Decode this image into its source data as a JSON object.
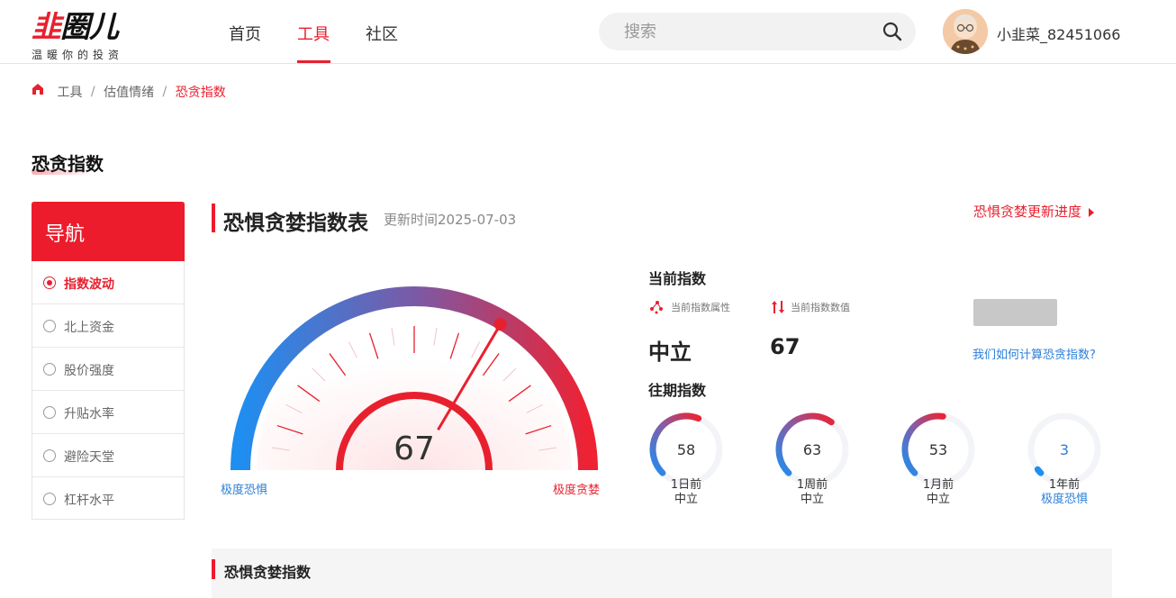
{
  "brand": {
    "logo": "韭圈儿",
    "slogan": "温暖你的投资",
    "accent": "#e8202e",
    "blue": "#2b7fd9"
  },
  "nav": {
    "items": [
      "首页",
      "工具",
      "社区"
    ],
    "active": 1
  },
  "search": {
    "placeholder": "搜索",
    "icon": "search-icon"
  },
  "user": {
    "name": "小韭菜_82451066",
    "avatar": "avatar-illustration"
  },
  "breadcrumb": {
    "home_icon": "home-icon",
    "items": [
      "工具",
      "估值情绪",
      "恐贪指数"
    ]
  },
  "page": {
    "title": "恐贪指数"
  },
  "sidebar": {
    "title": "导航",
    "items": [
      "指数波动",
      "北上资金",
      "股价强度",
      "升贴水率",
      "避险天堂",
      "杠杆水平"
    ],
    "active": 0
  },
  "section": {
    "title": "恐惧贪婪指数表",
    "update": "更新时间2025-07-03",
    "progress_link": "恐惧贪婪更新进度"
  },
  "gauge": {
    "value": 67,
    "min": 0,
    "max": 100,
    "left_label": "极度恐惧",
    "right_label": "极度贪婪"
  },
  "current": {
    "heading": "当前指数",
    "attr_label": "当前指数属性",
    "value_label": "当前指数数值",
    "attr": "中立",
    "value": "67",
    "how_link": "我们如何计算恐贪指数?"
  },
  "past": {
    "heading": "往期指数",
    "items": [
      {
        "value": "58",
        "period": "1日前",
        "state": "中立"
      },
      {
        "value": "63",
        "period": "1周前",
        "state": "中立"
      },
      {
        "value": "53",
        "period": "1月前",
        "state": "中立"
      },
      {
        "value": "3",
        "period": "1年前",
        "state": "极度恐惧"
      }
    ]
  },
  "bottom": {
    "title": "恐惧贪婪指数"
  }
}
